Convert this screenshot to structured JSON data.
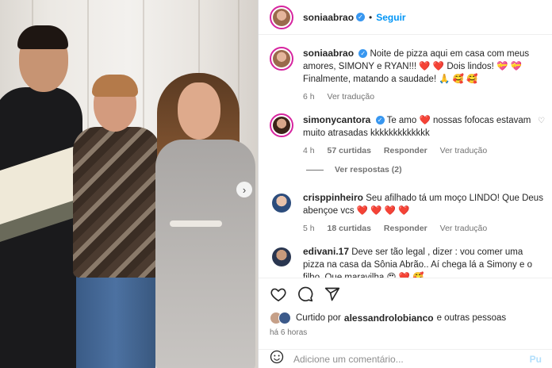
{
  "post": {
    "author": "soniaabrao",
    "follow_label": "Seguir",
    "caption": "Noite de pizza aqui em casa com meus amores, SIMONY e RYAN!!! ❤️ ❤️ Dois lindos! 💝 💝 Finalmente, matando a saudade! 🙏 🥰 🥰",
    "caption_time": "6 h",
    "caption_translate": "Ver tradução"
  },
  "comments": [
    {
      "user": "simonycantora",
      "verified": true,
      "text": "Te amo ❤️ nossas fofocas estavam muito atrasadas kkkkkkkkkkkkk",
      "time": "4 h",
      "likes": "57 curtidas",
      "reply": "Responder",
      "translate": "Ver tradução",
      "view_replies": "Ver respostas (2)"
    },
    {
      "user": "crisppinheiro",
      "text": "Seu afilhado tá um moço LINDO! Que Deus abençoe vcs ❤️ ❤️ ❤️ ❤️",
      "time": "5 h",
      "likes": "18 curtidas",
      "reply": "Responder",
      "translate": "Ver tradução"
    },
    {
      "user": "edivani.17",
      "text": "Deve ser tão legal , dizer : vou comer uma pizza na casa da Sônia Abrão.. Aí chega lá a Simony e o filho. Que maravilha 😍 ❤️ 🥰"
    }
  ],
  "liked_by": {
    "prefix": "Curtido por",
    "user": "alessandrolobianco",
    "suffix": "e outras pessoas"
  },
  "timestamp": "há 6 horas",
  "comment_input": {
    "placeholder": "Adicione um comentário...",
    "post_label": "Pu"
  },
  "icons": [
    "heart-icon",
    "comment-icon",
    "share-icon",
    "emoji-icon",
    "verified-icon",
    "carousel-next-icon"
  ],
  "colors": {
    "follow": "#0095f6",
    "verified": "#3897f0",
    "muted": "#737373",
    "heart": "#e0245e"
  }
}
